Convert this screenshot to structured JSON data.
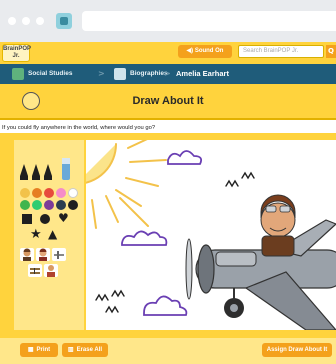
{
  "browser": {
    "url": ""
  },
  "header": {
    "logo_text": "BrainPOP Jr.",
    "sound_label": "Sound On",
    "search_placeholder": "Search BrainPOP Jr.",
    "search_button": "Q"
  },
  "breadcrumb": {
    "items": [
      "Social Studies",
      "Biographies",
      "Amelia Earhart"
    ],
    "separator": ">"
  },
  "page": {
    "title": "Draw About It",
    "prompt": "If you could fly anywhere in the world, where would you go?"
  },
  "tools": {
    "colors": [
      "#f2c24a",
      "#e67e22",
      "#e74c3c",
      "#f58cc8",
      "#ffffff",
      "#3fb54d",
      "#2ecc71",
      "#7d3c98",
      "#2c3e50",
      "#1f1f1f"
    ],
    "shapes": [
      "square",
      "circle",
      "heart",
      "star",
      "triangle"
    ],
    "brushes": [
      "thin-pen",
      "medium-pen",
      "thick-pen",
      "crayon"
    ],
    "stamps": [
      "amelia-earhart-stamp",
      "pilot-stamp",
      "plane-stamp",
      "biplane-stamp",
      "person-stamp"
    ]
  },
  "footer": {
    "print_label": "Print",
    "erase_label": "Erase All",
    "assign_label": "Assign Draw About It"
  },
  "colors": {
    "accent_yellow": "#ffd33d",
    "accent_orange": "#f4a11c",
    "nav_blue": "#1f5c7a"
  }
}
